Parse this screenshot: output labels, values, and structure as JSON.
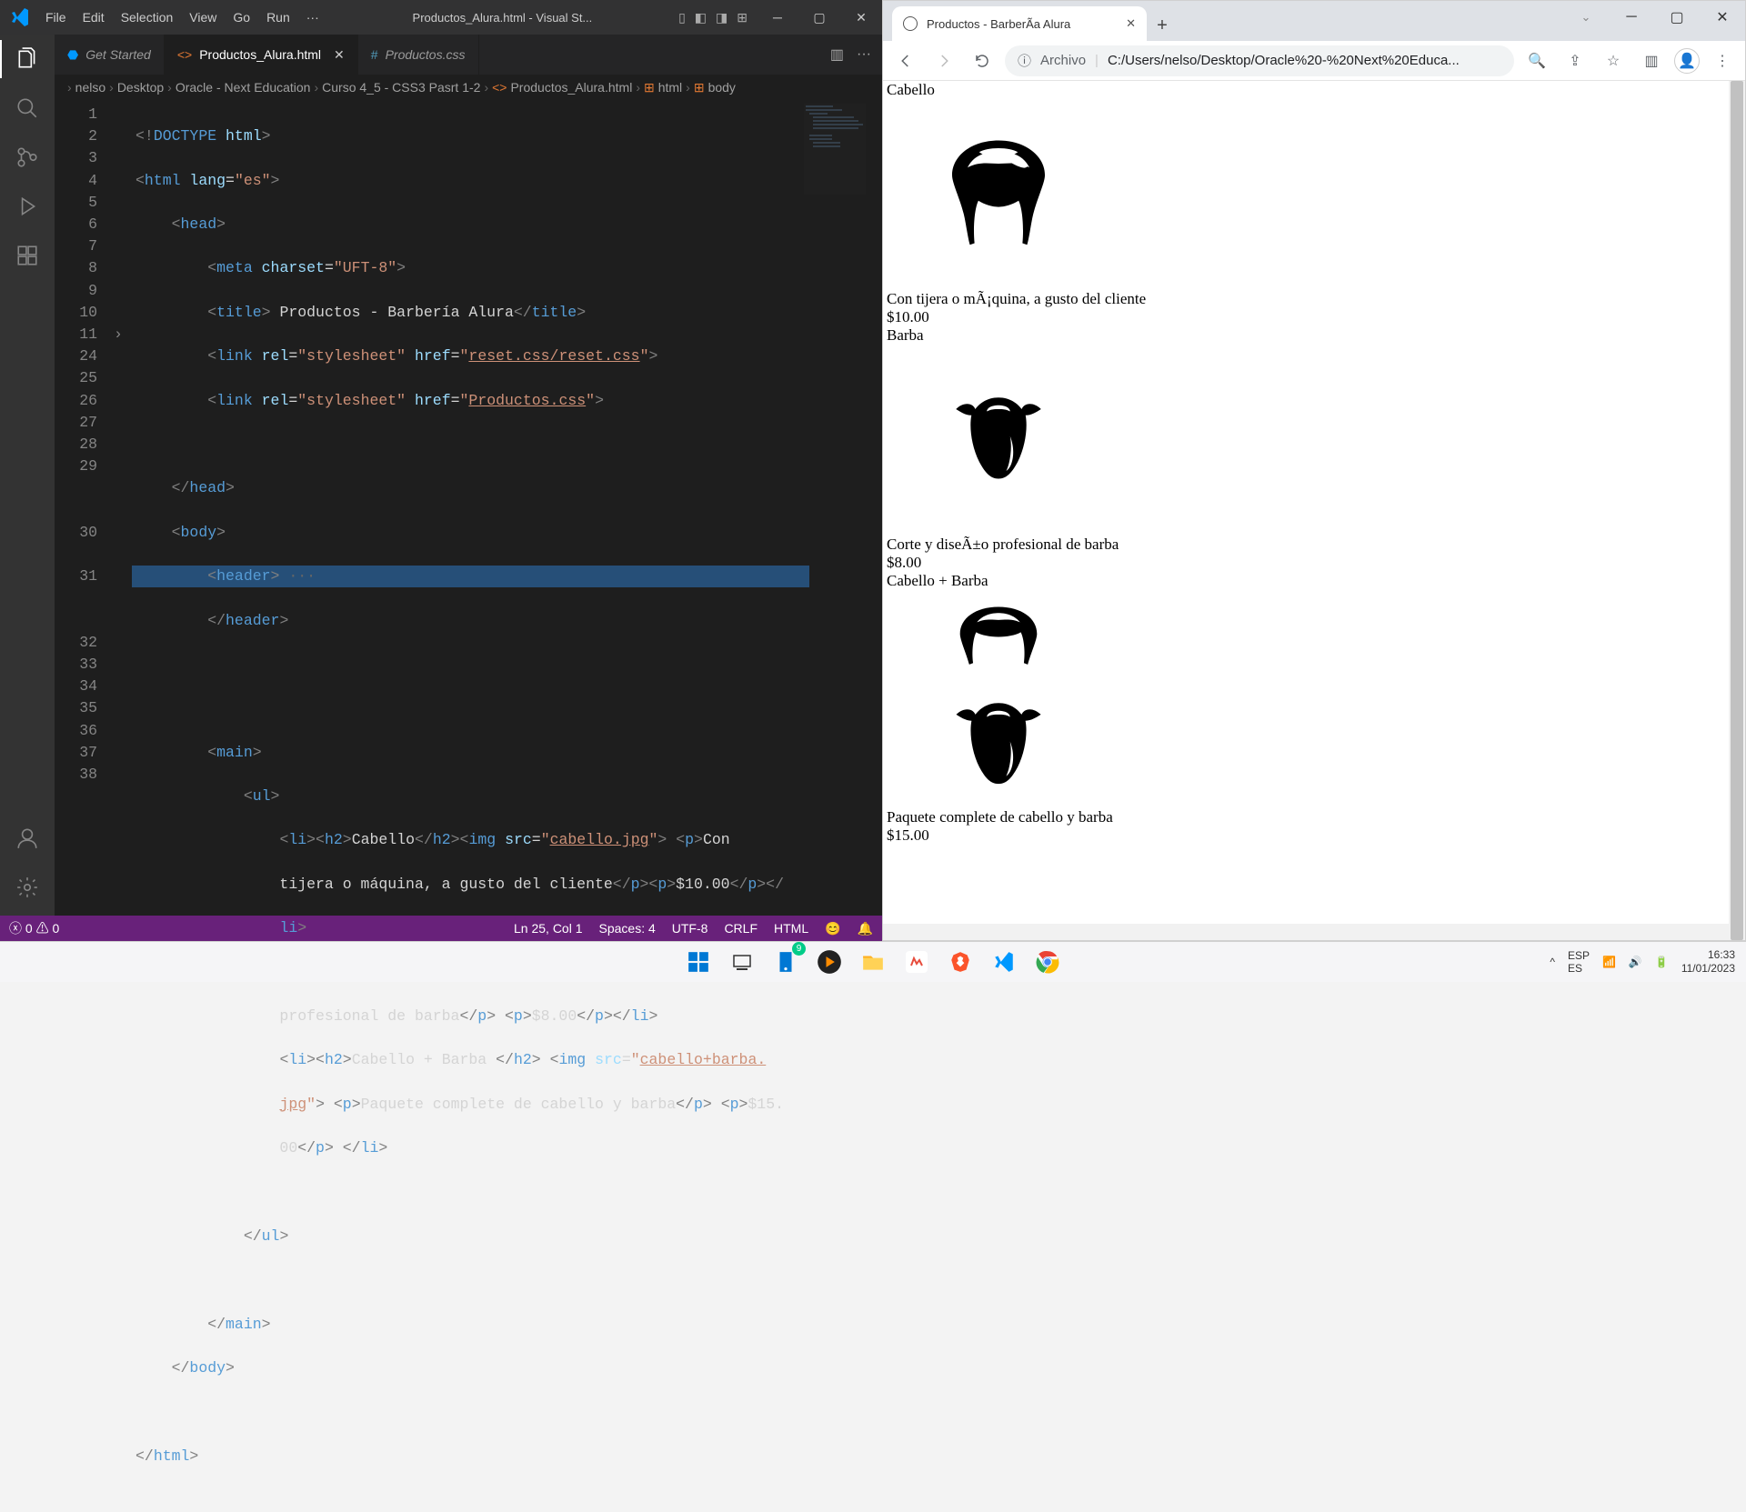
{
  "vscode": {
    "menu": [
      "File",
      "Edit",
      "Selection",
      "View",
      "Go",
      "Run",
      "···"
    ],
    "title": "Productos_Alura.html - Visual St...",
    "tabs": [
      {
        "label": "Get Started",
        "active": false
      },
      {
        "label": "Productos_Alura.html",
        "active": true
      },
      {
        "label": "Productos.css",
        "active": false
      }
    ],
    "breadcrumb": [
      "nelso",
      "Desktop",
      "Oracle - Next Education",
      "Curso 4_5 - CSS3 Pasrt 1-2",
      "Productos_Alura.html",
      "html",
      "body"
    ],
    "line_numbers": [
      "1",
      "2",
      "3",
      "4",
      "5",
      "6",
      "7",
      "8",
      "9",
      "10",
      "11",
      "24",
      "25",
      "26",
      "27",
      "28",
      "29",
      "",
      "",
      "30",
      "",
      "31",
      "",
      "",
      "32",
      "33",
      "34",
      "35",
      "36",
      "37",
      "38"
    ],
    "statusbar": {
      "errors": "0",
      "warnings": "0",
      "cursor": "Ln 25, Col 1",
      "spaces": "Spaces: 4",
      "encoding": "UTF-8",
      "eol": "CRLF",
      "lang": "HTML"
    }
  },
  "chrome": {
    "tab_title": "Productos - BarberÃ­a Alura",
    "scheme": "Archivo",
    "url": "C:/Users/nelso/Desktop/Oracle%20-%20Next%20Educa...",
    "content": {
      "h1_1": "Cabello",
      "p1_1": "Con tijera o mÃ¡quina, a gusto del cliente",
      "p1_2": "$10.00",
      "h1_2": "Barba",
      "p2_1": "Corte y diseÃ±o profesional de barba",
      "p2_2": "$8.00",
      "h1_3": "Cabello + Barba",
      "p3_1": "Paquete complete de cabello y barba",
      "p3_2": "$15.00"
    }
  },
  "system": {
    "lang1": "ESP",
    "lang2": "ES",
    "time": "16:33",
    "date": "11/01/2023"
  }
}
